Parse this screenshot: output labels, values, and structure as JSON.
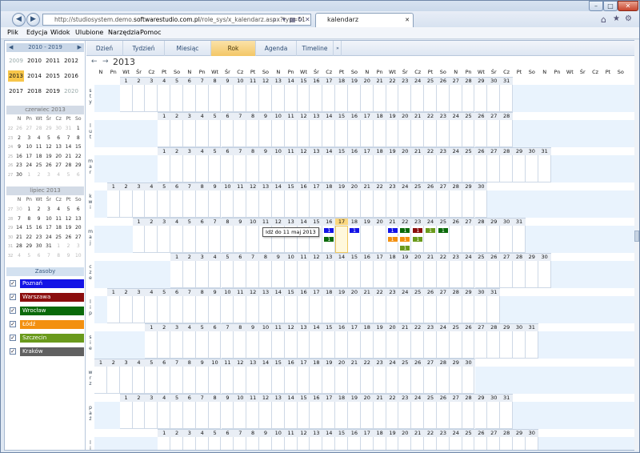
{
  "browser": {
    "url_prefix": "http://studiosystem.demo.",
    "url_domain": "softwarestudio.com.pl",
    "url_rest": "/role_sys/x_kalendarz.aspx?typ=01",
    "tab_title": "kalendarz"
  },
  "menu": [
    "Plik",
    "Edycja",
    "Widok",
    "Ulubione",
    "Narzędzia",
    "Pomoc"
  ],
  "left": {
    "range_label": "2010 - 2019",
    "years": [
      [
        "2009",
        "2010",
        "2011",
        "2012"
      ],
      [
        "2013",
        "2014",
        "2015",
        "2016"
      ],
      [
        "2017",
        "2018",
        "2019",
        "2020"
      ]
    ],
    "selected_year": "2013",
    "june_title": "czerwiec 2013",
    "july_title": "lipiec 2013",
    "weekdays": [
      "N",
      "Pn",
      "Wt",
      "Śr",
      "Cz",
      "Pt",
      "So"
    ],
    "resources_title": "Zasoby",
    "resources": [
      {
        "name": "Poznań",
        "color": "#1414e6"
      },
      {
        "name": "Warszawa",
        "color": "#8b0e0e"
      },
      {
        "name": "Wrocław",
        "color": "#0a6a0a"
      },
      {
        "name": "Łódź",
        "color": "#f39010"
      },
      {
        "name": "Szczecin",
        "color": "#6a9a1c"
      },
      {
        "name": "Kraków",
        "color": "#606060"
      }
    ]
  },
  "views": [
    "Dzień",
    "Tydzień",
    "Miesiąc",
    "Rok",
    "Agenda",
    "Timeline"
  ],
  "active_view": "Rok",
  "calendar": {
    "year": "2013",
    "day_headers": [
      "N",
      "Pn",
      "Wt",
      "Śr",
      "Cz",
      "Pt",
      "So",
      "N",
      "Pn",
      "Wt",
      "Śr",
      "Cz",
      "Pt",
      "So",
      "N",
      "Pn",
      "Wt",
      "Śr",
      "Cz",
      "Pt",
      "So",
      "N",
      "Pn",
      "Wt",
      "Śr",
      "Cz",
      "Pt",
      "So",
      "N",
      "Pn",
      "Wt",
      "Śr",
      "Cz",
      "Pt",
      "So",
      "N",
      "Pn",
      "Wt",
      "Śr",
      "Cz",
      "Pt",
      "So"
    ],
    "months": [
      {
        "label": "s t y",
        "offset": 2,
        "days": 31
      },
      {
        "label": "l u t",
        "offset": 5,
        "days": 28
      },
      {
        "label": "m a r",
        "offset": 5,
        "days": 31
      },
      {
        "label": "k w i",
        "offset": 1,
        "days": 30
      },
      {
        "label": "m a j",
        "offset": 3,
        "days": 31
      },
      {
        "label": "c z e",
        "offset": 6,
        "days": 30
      },
      {
        "label": "l i p",
        "offset": 1,
        "days": 31
      },
      {
        "label": "s i e",
        "offset": 4,
        "days": 31
      },
      {
        "label": "w r z",
        "offset": 0,
        "days": 30
      },
      {
        "label": "p a ź",
        "offset": 2,
        "days": 31
      },
      {
        "label": "l i s",
        "offset": 5,
        "days": 30
      }
    ],
    "events_may": [
      {
        "day": 16,
        "slot": 0,
        "color": "#1414e6",
        "text": "1"
      },
      {
        "day": 16,
        "slot": 1,
        "color": "#0a6a0a",
        "text": "1"
      },
      {
        "day": 18,
        "slot": 0,
        "color": "#1414e6",
        "text": "1"
      },
      {
        "day": 21,
        "slot": 0,
        "color": "#1414e6",
        "text": "1"
      },
      {
        "day": 21,
        "slot": 1,
        "color": "#f39010",
        "text": "1"
      },
      {
        "day": 22,
        "slot": 0,
        "color": "#0a6a0a",
        "text": "1"
      },
      {
        "day": 22,
        "slot": 1,
        "color": "#f39010",
        "text": "1"
      },
      {
        "day": 22,
        "slot": 2,
        "color": "#6a9a1c",
        "text": "1"
      },
      {
        "day": 22,
        "slot": 3,
        "color": "#606060",
        "text": "1"
      },
      {
        "day": 23,
        "slot": 0,
        "color": "#8b0e0e",
        "text": "1"
      },
      {
        "day": 23,
        "slot": 1,
        "color": "#6a9a1c",
        "text": "1"
      },
      {
        "day": 24,
        "slot": 0,
        "color": "#6a9a1c",
        "text": "1"
      },
      {
        "day": 25,
        "slot": 0,
        "color": "#0a6a0a",
        "text": "1"
      }
    ],
    "tooltip": "Idź do 11 maj 2013",
    "today_day": 17
  }
}
